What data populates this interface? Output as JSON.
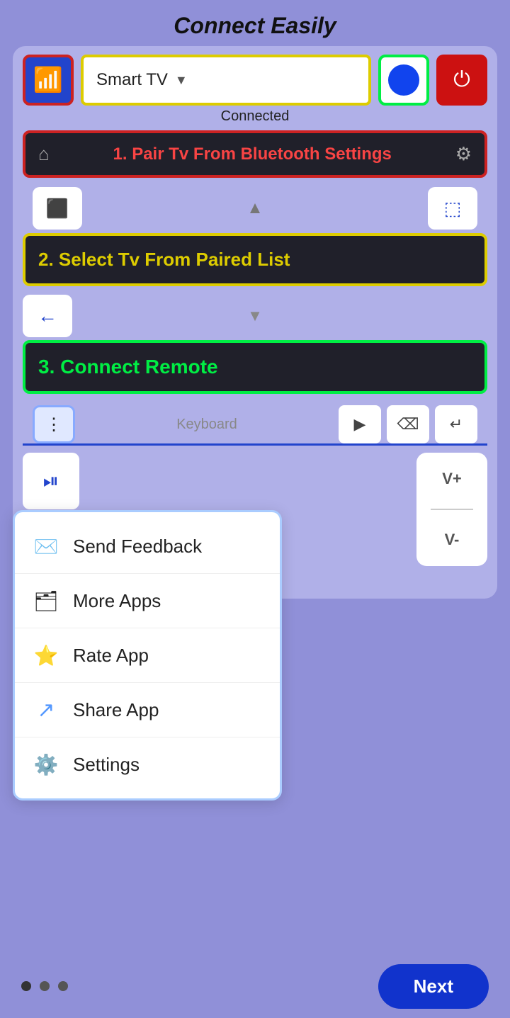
{
  "header": {
    "title": "Connect Easily"
  },
  "topbar": {
    "device_label": "Smart TV",
    "status_label": "Connected"
  },
  "instructions": {
    "step1": "1. Pair Tv From Bluetooth Settings",
    "step2": "2. Select Tv From Paired List",
    "step3": "3. Connect Remote"
  },
  "keyboard": {
    "tab_label": "Keyboard"
  },
  "volume": {
    "up": "V+",
    "down": "V-"
  },
  "menu": {
    "items": [
      {
        "id": "send-feedback",
        "label": "Send Feedback",
        "icon": "✉"
      },
      {
        "id": "more-apps",
        "label": "More Apps",
        "icon": "🗂"
      },
      {
        "id": "rate-app",
        "label": "Rate App",
        "icon": "⭐"
      },
      {
        "id": "share-app",
        "label": "Share App",
        "icon": "↗"
      },
      {
        "id": "settings",
        "label": "Settings",
        "icon": "⚙"
      }
    ]
  },
  "pagination": {
    "dots": 3,
    "active_index": 0
  },
  "next_button": {
    "label": "Next"
  }
}
